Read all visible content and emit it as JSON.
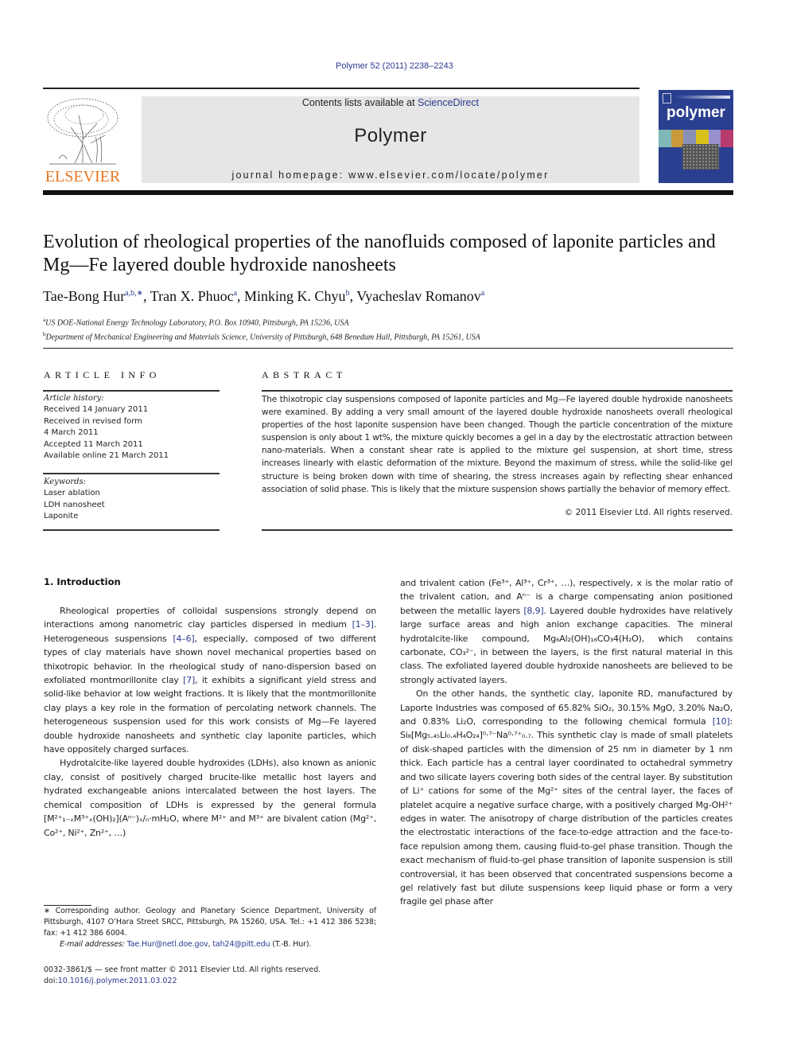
{
  "header": {
    "citation": "Polymer 52 (2011) 2238–2243",
    "contents_prefix": "Contents lists available at ",
    "contents_link": "ScienceDirect",
    "journal_name": "Polymer",
    "homepage_line": "journal homepage: www.elsevier.com/locate/polymer",
    "publisher_logo_text": "ELSEVIER",
    "cover_title": "polymer",
    "colors": {
      "link": "#2b3990",
      "publisher_orange": "#e87722",
      "cover_blue": "#2a3f8f",
      "masthead_gray": "#e6e6e6"
    }
  },
  "article": {
    "title": "Evolution of rheological properties of the nanofluids composed of laponite particles and Mg—Fe layered double hydroxide nanosheets",
    "authors": [
      {
        "name": "Tae-Bong Hur",
        "marks": "a,b,∗"
      },
      {
        "name": "Tran X. Phuoc",
        "marks": "a"
      },
      {
        "name": "Minking K. Chyu",
        "marks": "b"
      },
      {
        "name": "Vyacheslav Romanov",
        "marks": "a"
      }
    ],
    "affiliations": [
      {
        "mark": "a",
        "text": "US DOE-National Energy Technology Laboratory, P.O. Box 10940, Pittsburgh, PA 15236, USA"
      },
      {
        "mark": "b",
        "text": "Department of Mechanical Engineering and Materials Science, University of Pittsburgh, 648 Benedum Hall, Pittsburgh, PA 15261, USA"
      }
    ]
  },
  "article_info": {
    "heading": "ARTICLE INFO",
    "history_label": "Article history:",
    "history": [
      "Received 14 January 2011",
      "Received in revised form",
      "4 March 2011",
      "Accepted 11 March 2011",
      "Available online 21 March 2011"
    ],
    "keywords_label": "Keywords:",
    "keywords": [
      "Laser ablation",
      "LDH nanosheet",
      "Laponite"
    ]
  },
  "abstract": {
    "heading": "ABSTRACT",
    "text": "The thixotropic clay suspensions composed of laponite particles and Mg—Fe layered double hydroxide nanosheets were examined. By adding a very small amount of the layered double hydroxide nanosheets overall rheological properties of the host laponite suspension have been changed. Though the particle concentration of the mixture suspension is only about 1 wt%, the mixture quickly becomes a gel in a day by the electrostatic attraction between nano-materials. When a constant shear rate is applied to the mixture gel suspension, at short time, stress increases linearly with elastic deformation of the mixture. Beyond the maximum of stress, while the solid-like gel structure is being broken down with time of shearing, the stress increases again by reflecting shear enhanced association of solid phase. This is likely that the mixture suspension shows partially the behavior of memory effect.",
    "copyright": "© 2011 Elsevier Ltd. All rights reserved."
  },
  "introduction": {
    "heading": "1.  Introduction",
    "p1": {
      "t1": "Rheological properties of colloidal suspensions strongly depend on interactions among nanometric clay particles dispersed in medium ",
      "r1": "[1–3]",
      "t2": ". Heterogeneous suspensions ",
      "r2": "[4–6]",
      "t3": ", especially, composed of two different types of clay materials have shown novel mechanical properties based on thixotropic behavior. In the rheological study of nano-dispersion based on exfoliated montmorillonite clay ",
      "r3": "[7]",
      "t4": ", it exhibits a significant yield stress and solid-like behavior at low weight fractions. It is likely that the montmorillonite clay plays a key role in the formation of percolating network channels. The heterogeneous suspension used for this work consists of Mg—Fe layered double hydroxide nanosheets and synthetic clay laponite particles, which have oppositely charged surfaces."
    },
    "p2_left": {
      "t1": "Hydrotalcite-like layered double hydroxides (LDHs), also known as anionic clay, consist of positively charged brucite-like metallic host layers and hydrated exchangeable anions intercalated between the host layers. The chemical composition of LDHs is expressed by the general formula ",
      "formula": "[M²⁺₁₋ₓM³⁺ₓ(OH)₂](Aⁿ⁻)ₓ/ₙ·mH₂O",
      "t2": ", where M²⁺ and M³⁺ are bivalent cation (Mg²⁺, Co²⁺, Ni²⁺, Zn²⁺, …)"
    },
    "p2_right": {
      "t1": "and trivalent cation (Fe³⁺, Al³⁺, Cr³⁺, …), respectively, x is the molar ratio of the trivalent cation, and Aⁿ⁻ is a charge compensating anion positioned between the metallic layers ",
      "r1": "[8,9]",
      "t2": ". Layered double hydroxides have relatively large surface areas and high anion exchange capacities. The mineral hydrotalcite-like compound, Mg₆Al₂(OH)₁₆CO₃4(H₂O), which contains carbonate, CO₃²⁻, in between the layers, is the first natural material in this class. The exfoliated layered double hydroxide nanosheets are believed to be strongly activated layers."
    },
    "p3": {
      "t1": "On the other hands, the synthetic clay, laponite RD, manufactured by Laporte Industries was composed of 65.82% SiO₂, 30.15% MgO, 3.20% Na₂O, and 0.83% Li₂O, corresponding to the following chemical formula ",
      "r1": "[10]",
      "t2": ": Si₈[Mg₅.₄₅Li₀.₄H₄O₂₄]⁰·⁷⁻Na⁰·⁷⁺₀.₇. This synthetic clay is made of small platelets of disk-shaped particles with the dimension of 25 nm in diameter by 1 nm thick. Each particle has a central layer coordinated to octahedral symmetry and two silicate layers covering both sides of the central layer. By substitution of Li⁺ cations for some of the Mg²⁺ sites of the central layer, the faces of platelet acquire a negative surface charge, with a positively charged Mg-OH²⁺ edges in water. The anisotropy of charge distribution of the particles creates the electrostatic interactions of the face-to-edge attraction and the face-to-face repulsion among them, causing fluid-to-gel phase transition. Though the exact mechanism of fluid-to-gel phase transition of laponite suspension is still controversial, it has been observed that concentrated suspensions become a gel relatively fast but dilute suspensions keep liquid phase or form a very fragile gel phase after"
    }
  },
  "footnotes": {
    "corresponding": "∗ Corresponding author. Geology and Planetary Science Department, University of Pittsburgh, 4107 O’Hara Street SRCC, Pittsburgh, PA 15260, USA. Tel.: +1 412 386 5238; fax: +1 412 386 6004.",
    "email_label": "E-mail addresses:",
    "email1": "Tae.Hur@netl.doe.gov",
    "email_sep": ", ",
    "email2": "tah24@pitt.edu",
    "email_suffix": " (T.-B. Hur).",
    "front_matter": "0032-3861/$ — see front matter © 2011 Elsevier Ltd. All rights reserved.",
    "doi_prefix": "doi:",
    "doi": "10.1016/j.polymer.2011.03.022"
  }
}
